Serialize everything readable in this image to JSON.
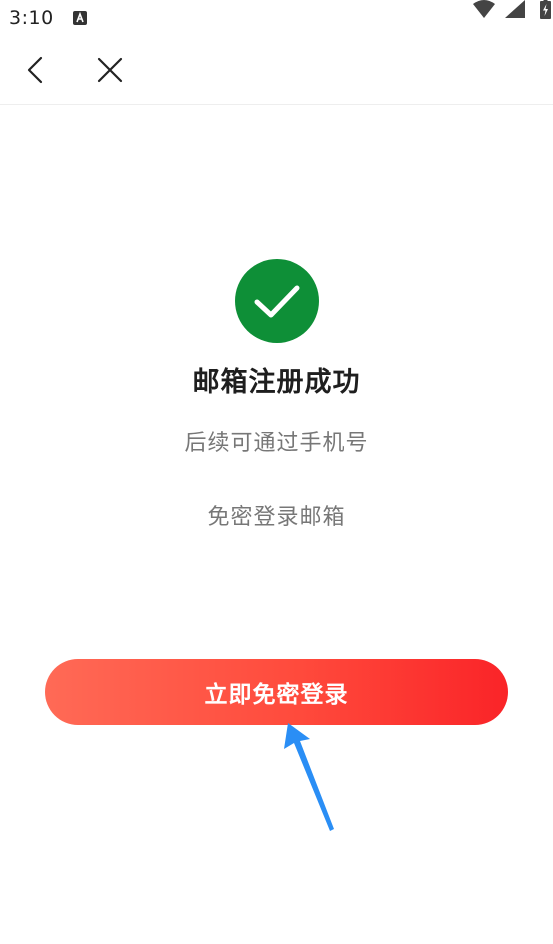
{
  "status_bar": {
    "time": "3:10",
    "icons": [
      "app-a-icon",
      "wifi-icon",
      "signal-icon",
      "battery-icon"
    ]
  },
  "nav": {
    "icons": [
      "back-icon",
      "close-icon"
    ]
  },
  "main": {
    "success_icon": "check-circle-icon",
    "title": "邮箱注册成功",
    "desc_line1": "后续可通过手机号",
    "desc_line2": "免密登录邮箱",
    "login_button_label": "立即免密登录"
  },
  "annotation": {
    "icon": "pointer-arrow-icon",
    "color": "#2a8ef5"
  },
  "colors": {
    "success_green": "#0e8f37",
    "button_gradient_start": "#ff6a56",
    "button_gradient_end": "#fa2428"
  }
}
